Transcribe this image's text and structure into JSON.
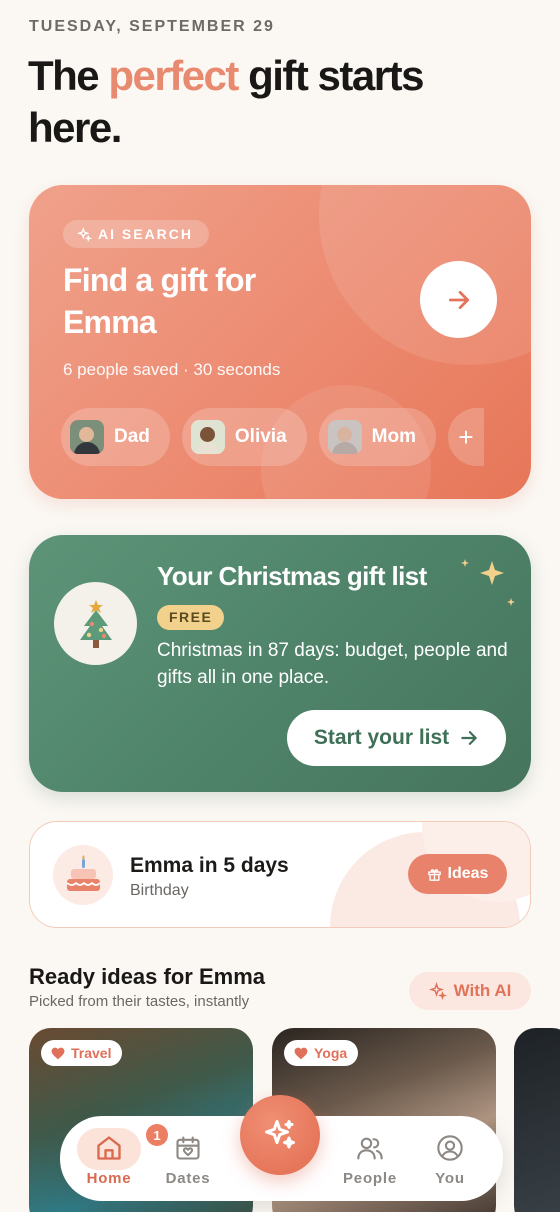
{
  "header": {
    "date": "TUESDAY, SEPTEMBER 29",
    "headline_part1": "The ",
    "headline_accent": "perfect",
    "headline_part2": " gift starts here."
  },
  "ai_search": {
    "badge": "AI SEARCH",
    "title": "Find a gift for Emma",
    "subtitle": "6 people saved · 30 seconds",
    "people": [
      {
        "name": "Dad"
      },
      {
        "name": "Olivia"
      },
      {
        "name": "Mom"
      }
    ],
    "add_label": "+"
  },
  "christmas": {
    "title": "Your Christmas gift list",
    "badge": "FREE",
    "description": "Christmas in 87 days: budget, people and gifts all in one place.",
    "button": "Start your list"
  },
  "birthday": {
    "name": "Emma in 5 days",
    "type": "Birthday",
    "button": "Ideas"
  },
  "ready_ideas": {
    "title": "Ready ideas for Emma",
    "subtitle": "Picked from their tastes, instantly",
    "with_ai": "With AI",
    "cards": [
      {
        "tag": "Travel"
      },
      {
        "tag": "Yoga"
      }
    ]
  },
  "nav": {
    "home": "Home",
    "dates": "Dates",
    "dates_badge": "1",
    "people": "People",
    "you": "You"
  },
  "colors": {
    "accent": "#e88a6f",
    "green": "#4f846a",
    "background": "#fbf8f4"
  }
}
